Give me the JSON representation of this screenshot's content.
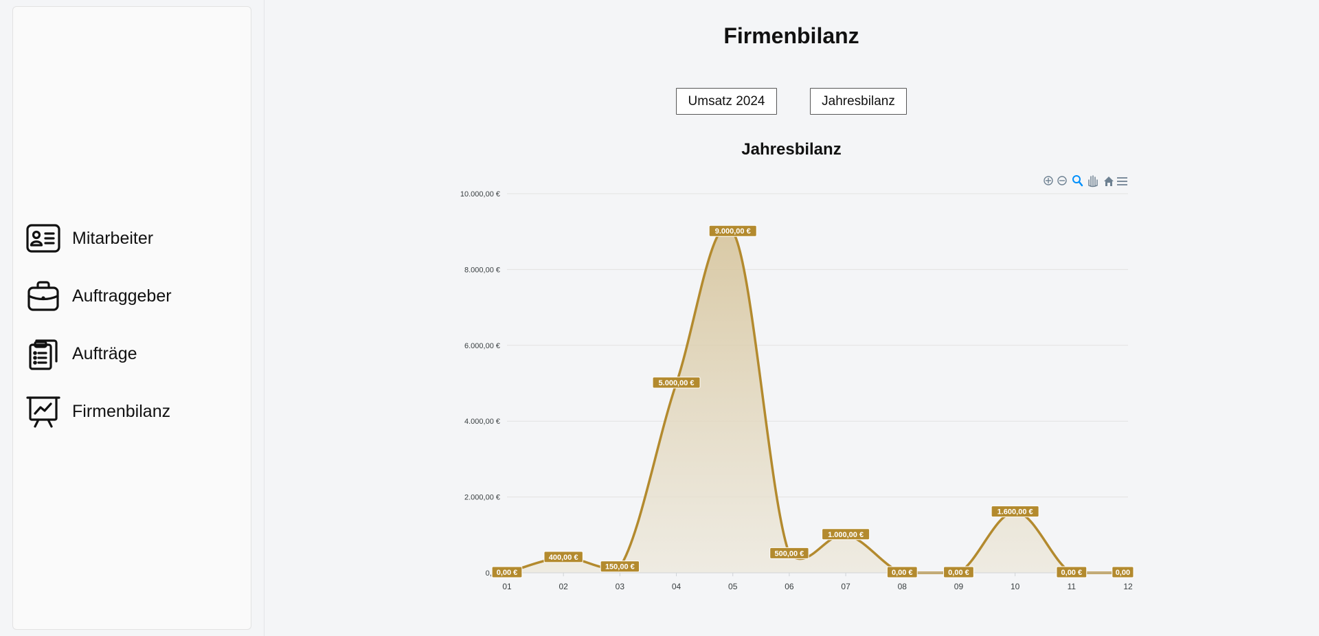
{
  "sidebar": {
    "items": [
      {
        "label": "Mitarbeiter",
        "icon": "employee-card-icon"
      },
      {
        "label": "Auftraggeber",
        "icon": "briefcase-icon"
      },
      {
        "label": "Aufträge",
        "icon": "clipboard-list-icon"
      },
      {
        "label": "Firmenbilanz",
        "icon": "presentation-chart-icon"
      }
    ]
  },
  "header": {
    "title": "Firmenbilanz"
  },
  "buttons": {
    "umsatz_label": "Umsatz 2024",
    "jahresbilanz_label": "Jahresbilanz"
  },
  "colors": {
    "series": "#b38a2e",
    "area": "#d9c9a0",
    "label_bg": "#b38a2e",
    "label_text": "#ffffff",
    "toolbar": "#6e8192",
    "toolbar_active": "#008ffb"
  },
  "toolbar": [
    "zoom-in-icon",
    "zoom-out-icon",
    "zoom-selection-icon",
    "pan-hand-icon",
    "reset-home-icon",
    "menu-icon"
  ],
  "chart_data": {
    "type": "area",
    "title": "Jahresbilanz",
    "categories": [
      "01",
      "02",
      "03",
      "04",
      "05",
      "06",
      "07",
      "08",
      "09",
      "10",
      "11",
      "12"
    ],
    "values": [
      0,
      400,
      150,
      5000,
      9000,
      500,
      1000,
      0,
      0,
      1600,
      0,
      0
    ],
    "data_labels": [
      "0,00 €",
      "400,00 €",
      "150,00 €",
      "5.000,00 €",
      "9.000,00 €",
      "500,00 €",
      "1.000,00 €",
      "0,00 €",
      "0,00 €",
      "1.600,00 €",
      "0,00 €",
      "0,00"
    ],
    "y_ticks": [
      0,
      2000,
      4000,
      6000,
      8000,
      10000
    ],
    "y_tick_labels": [
      "0,00",
      "2.000,00 €",
      "4.000,00 €",
      "6.000,00 €",
      "8.000,00 €",
      "10.000,00 €"
    ],
    "ylim": [
      0,
      10000
    ],
    "grid": true,
    "curve": "smooth",
    "xlabel": "",
    "ylabel": ""
  }
}
